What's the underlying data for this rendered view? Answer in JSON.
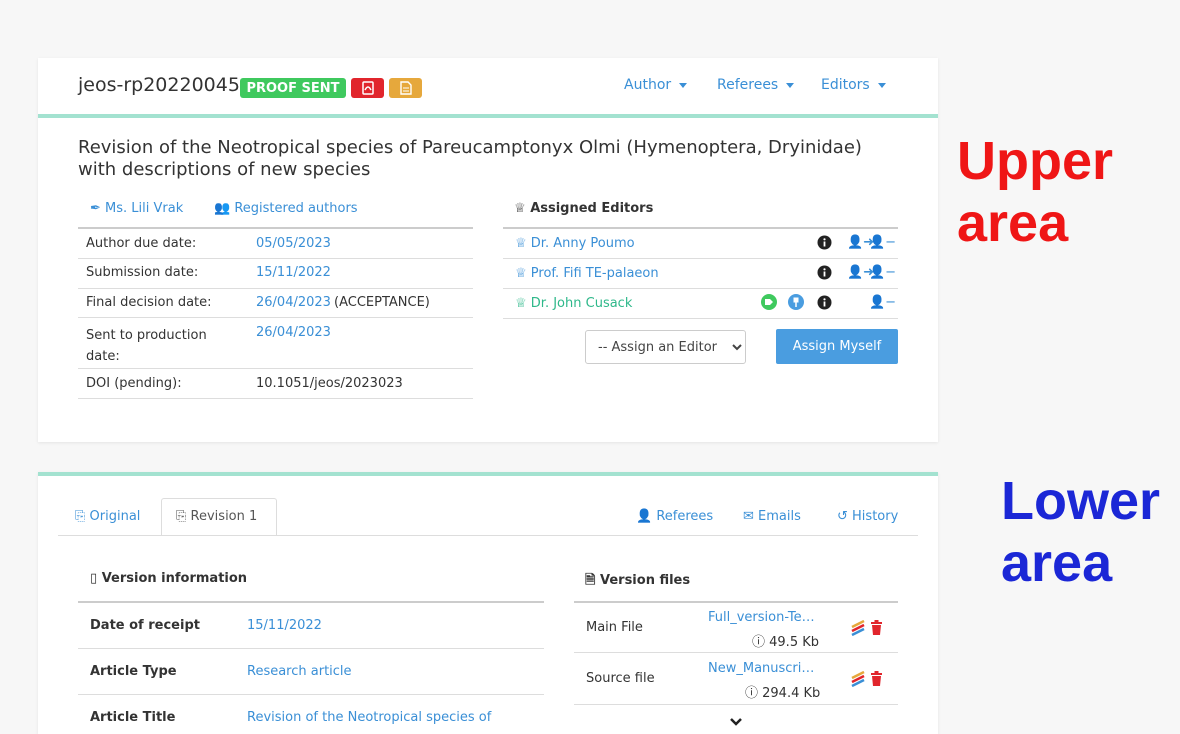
{
  "manuscript": {
    "id": "jeos-rp20220045",
    "status_badge": "PROOF SENT",
    "title": "Revision of the Neotropical species of Pareucamptonyx Olmi (Hymenoptera, Dryinidae) with descriptions of new species"
  },
  "nav": {
    "author": "Author",
    "referees": "Referees",
    "editors": "Editors"
  },
  "colors": {
    "accent": "#3a8fd6",
    "badge_green": "#3fc95e",
    "badge_red": "#e1252c",
    "badge_yellow": "#e6a83c",
    "divider": "#a3e2d0"
  },
  "authors": {
    "contact": "Ms. Lili Vrak",
    "registered": "Registered authors"
  },
  "details": [
    {
      "label": "Author due date:",
      "value": "05/05/2023",
      "extra": ""
    },
    {
      "label": "Submission date:",
      "value": "15/11/2022",
      "extra": ""
    },
    {
      "label": "Final decision date:",
      "value": "26/04/2023",
      "extra": "(ACCEPTANCE)"
    },
    {
      "label": "Sent to production date:",
      "value": "26/04/2023",
      "extra": ""
    },
    {
      "label": "DOI (pending):",
      "value": "10.1051/jeos/2023023",
      "extra": ""
    }
  ],
  "editors": {
    "heading": "Assigned Editors",
    "list": [
      "Dr. Anny Poumo",
      "Prof. Fifi TE-palaeon",
      "Dr. John Cusack"
    ],
    "select_placeholder": "-- Assign an Editor",
    "assign_myself": "Assign Myself"
  },
  "tabs": {
    "original": "Original",
    "revision": "Revision 1",
    "referees": "Referees",
    "emails": "Emails",
    "history": "History"
  },
  "version_info": {
    "heading": "Version information",
    "rows": [
      {
        "label": "Date of receipt",
        "value": "15/11/2022"
      },
      {
        "label": "Article Type",
        "value": "Research article"
      },
      {
        "label": "Article Title",
        "value": "Revision of the Neotropical species of"
      }
    ]
  },
  "version_files": {
    "heading": "Version files",
    "files": [
      {
        "label": "Main File",
        "name": "Full_version-Te…",
        "size": "49.5 Kb"
      },
      {
        "label": "Source file",
        "name": "New_Manuscri…",
        "size": "294.4 Kb"
      }
    ]
  },
  "annotations": {
    "upper": [
      "Upper",
      "area"
    ],
    "lower": [
      "Lower",
      "area"
    ],
    "upper_color": "#ef1616",
    "lower_color": "#1b27d6"
  }
}
